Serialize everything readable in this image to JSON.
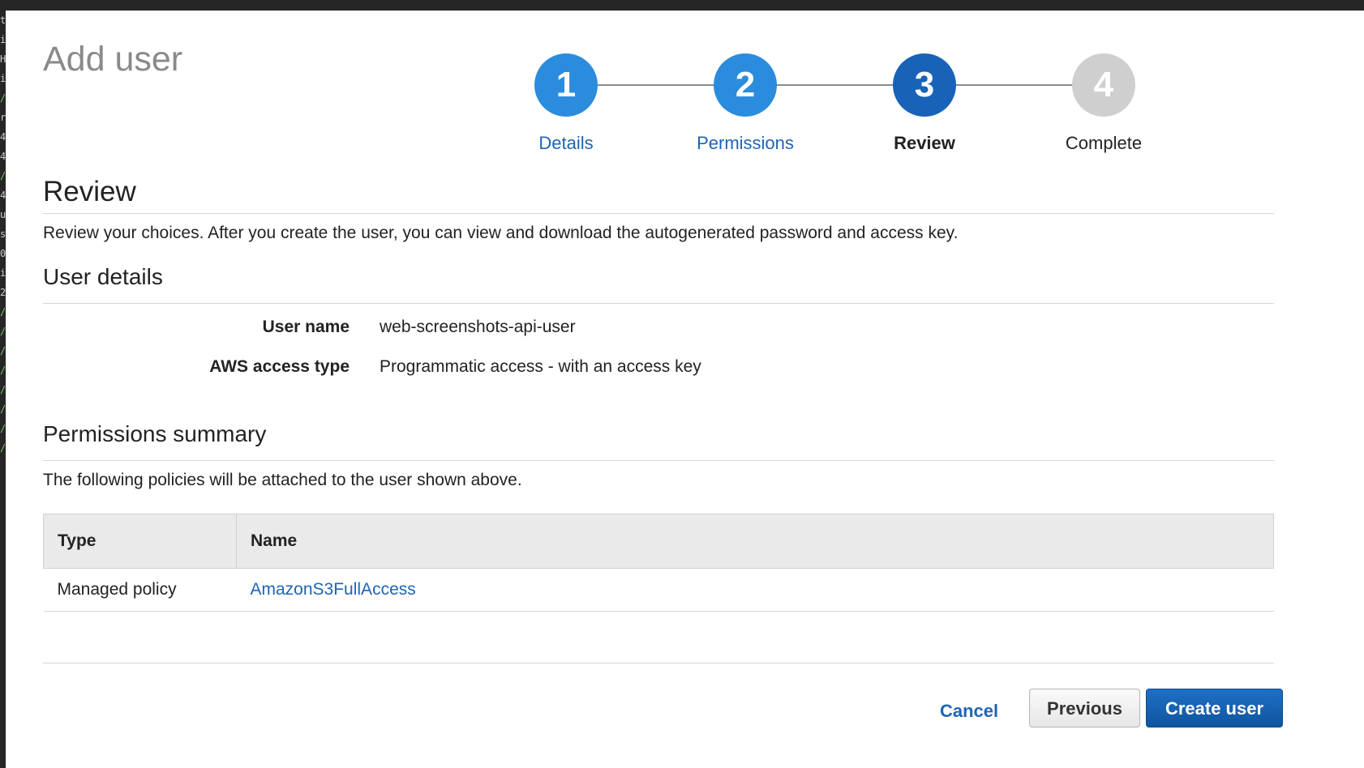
{
  "page": {
    "title": "Add user"
  },
  "stepper": {
    "steps": [
      {
        "number": "1",
        "label": "Details",
        "state": "done"
      },
      {
        "number": "2",
        "label": "Permissions",
        "state": "done"
      },
      {
        "number": "3",
        "label": "Review",
        "state": "current"
      },
      {
        "number": "4",
        "label": "Complete",
        "state": "todo"
      }
    ]
  },
  "review": {
    "heading": "Review",
    "description": "Review your choices. After you create the user, you can view and download the autogenerated password and access key."
  },
  "user_details": {
    "heading": "User details",
    "fields": [
      {
        "label": "User name",
        "value": "web-screenshots-api-user"
      },
      {
        "label": "AWS access type",
        "value": "Programmatic access - with an access key"
      }
    ]
  },
  "permissions": {
    "heading": "Permissions summary",
    "description": "The following policies will be attached to the user shown above.",
    "columns": [
      "Type",
      "Name"
    ],
    "rows": [
      {
        "type": "Managed policy",
        "name": "AmazonS3FullAccess"
      }
    ]
  },
  "actions": {
    "cancel": "Cancel",
    "previous": "Previous",
    "create": "Create user"
  },
  "colors": {
    "link_blue": "#1e64b4",
    "step_done": "#2b8cdd",
    "step_current": "#1862b8",
    "step_todo": "#cfcfcf",
    "primary_button": "#1162b6"
  }
}
